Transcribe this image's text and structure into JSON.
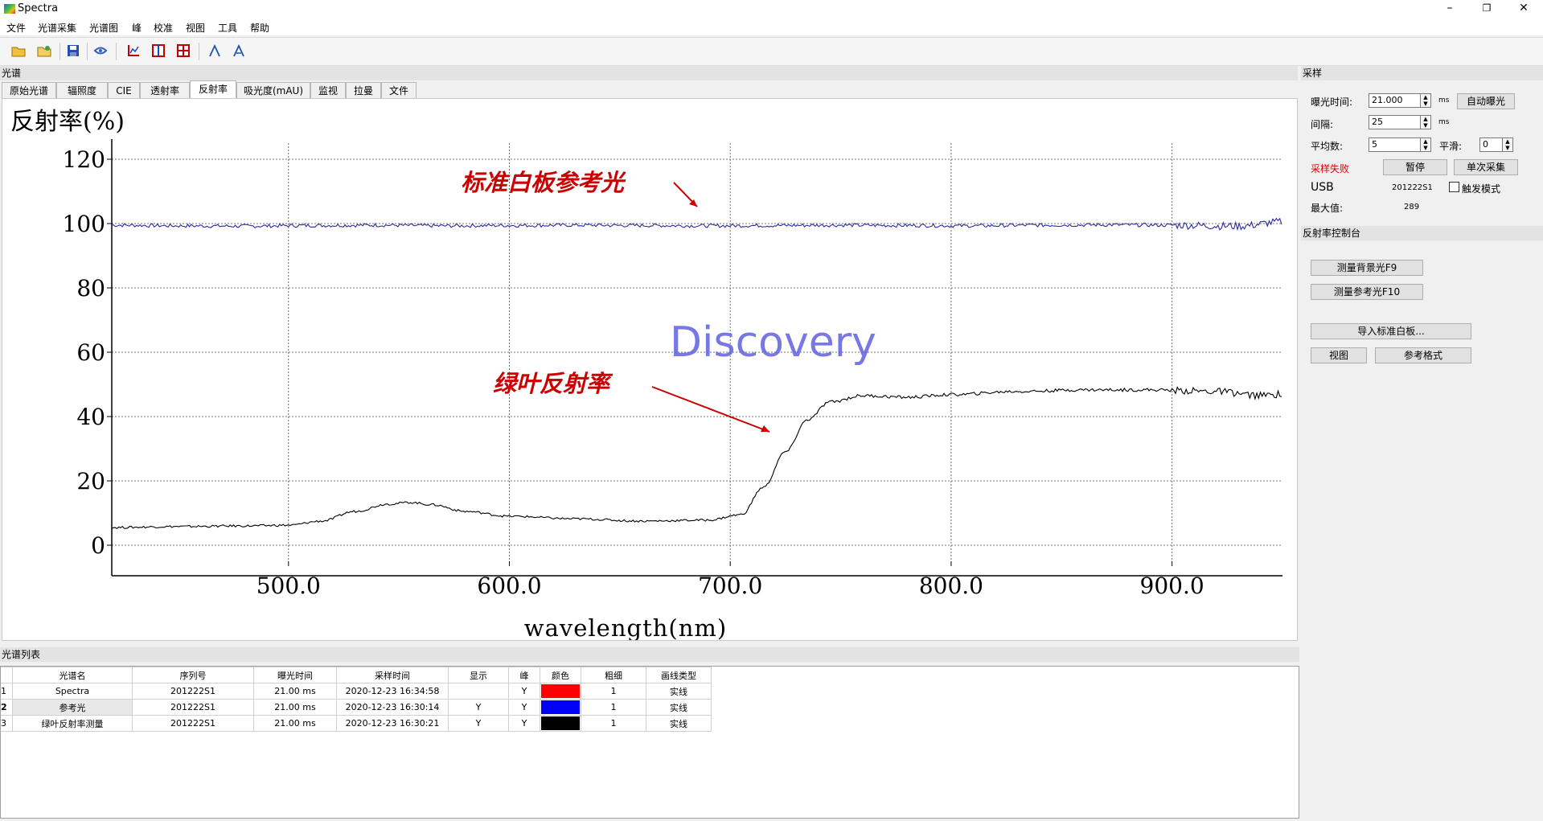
{
  "window": {
    "title": "Spectra",
    "controls": [
      "–",
      "❐",
      "✕"
    ]
  },
  "menu": [
    "文件",
    "光谱采集",
    "光谱图",
    "峰",
    "校准",
    "视图",
    "工具",
    "帮助"
  ],
  "toolbar_icons": [
    "open-icon",
    "open-folder-icon",
    "save-icon",
    "acquire-icon",
    "chart-icon",
    "split-view-icon",
    "grid-view-icon",
    "peak-icon",
    "peak-label-icon"
  ],
  "spectrum_panel": {
    "title": "光谱",
    "tabs": [
      "原始光谱",
      "辐照度",
      "CIE",
      "透射率",
      "反射率",
      "吸光度(mAU)",
      "监视",
      "拉曼",
      "文件"
    ],
    "active_tab": "反射率"
  },
  "chart_data": {
    "type": "line",
    "title": "反射率(%)",
    "xlabel": "wavelength(nm)",
    "ylabel": "",
    "xlim": [
      420,
      950
    ],
    "ylim": [
      -5,
      125
    ],
    "xticks": [
      "500.0",
      "600.0",
      "700.0",
      "800.0",
      "900.0"
    ],
    "xtick_values": [
      500,
      600,
      700,
      800,
      900
    ],
    "yticks": [
      "0",
      "20",
      "40",
      "60",
      "80",
      "100",
      "120"
    ],
    "ytick_values": [
      0,
      20,
      40,
      60,
      80,
      100,
      120
    ],
    "grid": true,
    "series": [
      {
        "color": "#2a2aa0",
        "x": [
          420,
          450,
          480,
          510,
          540,
          570,
          600,
          630,
          660,
          690,
          720,
          750,
          780,
          810,
          840,
          870,
          900,
          930,
          950
        ],
        "y": [
          99.5,
          99.3,
          99.2,
          99.4,
          99.5,
          99.3,
          99.4,
          99.5,
          99.4,
          99.3,
          99.4,
          99.5,
          99.4,
          99.3,
          99.5,
          99.6,
          99.5,
          99.2,
          100.5
        ]
      },
      {
        "color": "#000000",
        "x": [
          420,
          450,
          480,
          500,
          515,
          530,
          545,
          555,
          565,
          580,
          600,
          630,
          660,
          690,
          705,
          715,
          725,
          735,
          745,
          760,
          780,
          800,
          830,
          860,
          890,
          920,
          940,
          950
        ],
        "y": [
          5.5,
          5.8,
          6.0,
          6.2,
          7.5,
          10.5,
          12.8,
          13.3,
          12.6,
          10.5,
          9.0,
          8.2,
          7.5,
          7.8,
          9.5,
          18,
          29,
          39,
          44.5,
          46.5,
          46,
          46.8,
          47.8,
          48.3,
          48.3,
          47.8,
          46.5,
          47
        ]
      }
    ],
    "annotations": [
      {
        "text": "标准白板参考光",
        "color": "#cc0000"
      },
      {
        "text": "绿叶反射率",
        "color": "#cc0000"
      }
    ],
    "watermark": "Discovery"
  },
  "acquisition": {
    "title": "采样",
    "exposure_label": "曝光时间:",
    "exposure_value": "21.000",
    "exposure_unit": "ms",
    "auto_exposure_button": "自动曝光",
    "interval_label": "间隔:",
    "interval_value": "25",
    "interval_unit": "ms",
    "average_label": "平均数:",
    "average_value": "5",
    "smooth_label": "平滑:",
    "smooth_value": "0",
    "status_text": "采样失败",
    "pause_button": "暂停",
    "single_button": "单次采集",
    "usb_label": "USB",
    "serial": "201222S1",
    "trigger_label": "触发模式",
    "max_label": "最大值:",
    "max_value": "289"
  },
  "reflectance_console": {
    "title": "反射率控制台",
    "measure_background_button": "测量背景光F9",
    "measure_reference_button": "测量参考光F10",
    "import_white_button": "导入标准白板...",
    "view_button": "视图",
    "ref_format_button": "参考格式"
  },
  "spectrum_list": {
    "title": "光谱列表",
    "columns": [
      "光谱名",
      "序列号",
      "曝光时间",
      "采样时间",
      "显示",
      "峰",
      "颜色",
      "粗细",
      "画线类型"
    ],
    "rows": [
      {
        "index": "1",
        "name": "Spectra",
        "serial": "201222S1",
        "exposure": "21.00 ms",
        "time": "2020-12-23 16:34:58",
        "show": "",
        "peak": "Y",
        "color": "#ff0000",
        "width": "1",
        "linetype": "实线"
      },
      {
        "index": "2",
        "name": "参考光",
        "serial": "201222S1",
        "exposure": "21.00 ms",
        "time": "2020-12-23 16:30:14",
        "show": "Y",
        "peak": "Y",
        "color": "#0000ff",
        "width": "1",
        "linetype": "实线"
      },
      {
        "index": "3",
        "name": "绿叶反射率测量",
        "serial": "201222S1",
        "exposure": "21.00 ms",
        "time": "2020-12-23 16:30:21",
        "show": "Y",
        "peak": "Y",
        "color": "#000000",
        "width": "1",
        "linetype": "实线"
      }
    ]
  }
}
